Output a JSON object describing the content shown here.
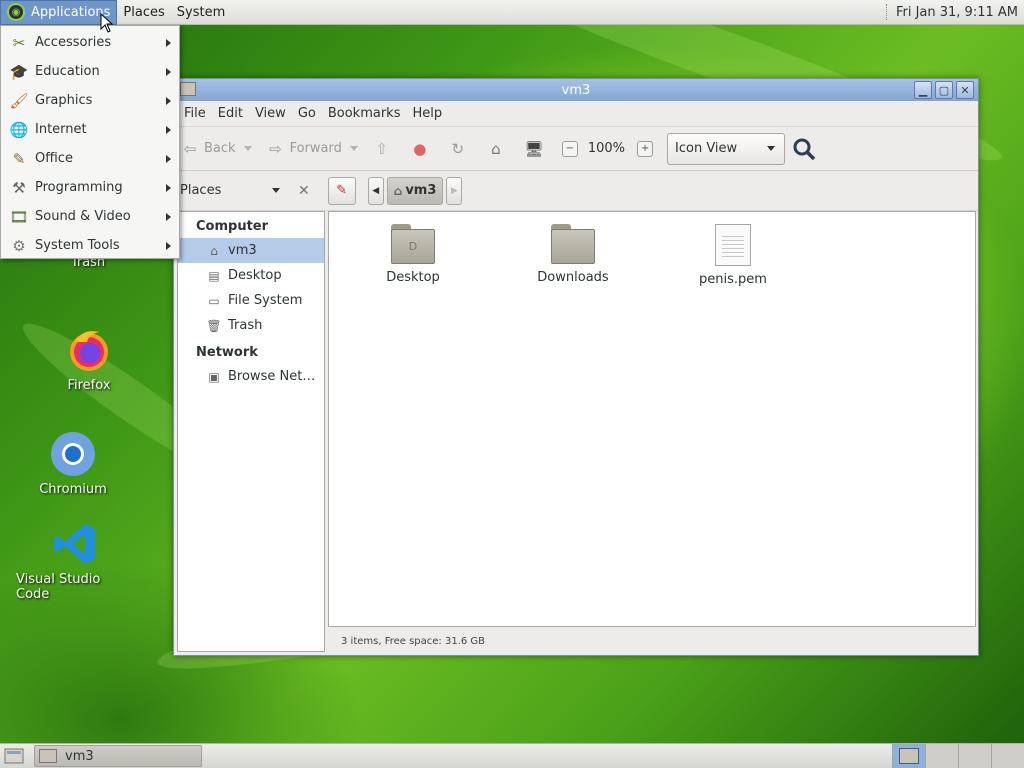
{
  "top_panel": {
    "menus": [
      "Applications",
      "Places",
      "System"
    ],
    "clock": "Fri Jan 31,  9:11 AM"
  },
  "apps_menu": {
    "items": [
      {
        "label": "Accessories",
        "icon": "accessories-icon"
      },
      {
        "label": "Education",
        "icon": "education-icon"
      },
      {
        "label": "Graphics",
        "icon": "graphics-icon"
      },
      {
        "label": "Internet",
        "icon": "internet-icon"
      },
      {
        "label": "Office",
        "icon": "office-icon"
      },
      {
        "label": "Programming",
        "icon": "programming-icon"
      },
      {
        "label": "Sound & Video",
        "icon": "sound-video-icon"
      },
      {
        "label": "System Tools",
        "icon": "system-tools-icon"
      }
    ]
  },
  "desktop": {
    "icons": [
      {
        "label": "Trash",
        "icon": "trash-icon"
      },
      {
        "label": "Firefox",
        "icon": "firefox-icon"
      },
      {
        "label": "Chromium",
        "icon": "chromium-icon"
      },
      {
        "label": "Visual Studio Code",
        "icon": "vscode-icon"
      }
    ]
  },
  "window": {
    "title": "vm3",
    "menubar": [
      "File",
      "Edit",
      "View",
      "Go",
      "Bookmarks",
      "Help"
    ],
    "toolbar": {
      "back": "Back",
      "forward": "Forward",
      "zoom": "100%",
      "view_mode": "Icon View"
    },
    "location": {
      "places_label": "Places",
      "crumb": "vm3"
    },
    "sidebar": {
      "sections": [
        {
          "title": "Computer",
          "items": [
            "vm3",
            "Desktop",
            "File System",
            "Trash"
          ]
        },
        {
          "title": "Network",
          "items": [
            "Browse Net…"
          ]
        }
      ],
      "selected": "vm3"
    },
    "files": [
      {
        "name": "Desktop",
        "type": "folder",
        "emblem": "D"
      },
      {
        "name": "Downloads",
        "type": "folder",
        "emblem": ""
      },
      {
        "name": "penis.pem",
        "type": "document",
        "emblem": ""
      }
    ],
    "status": "3 items, Free space: 31.6 GB"
  },
  "bottom_panel": {
    "task": "vm3",
    "workspaces": 4,
    "active_workspace": 1
  },
  "colors": {
    "selection": "#b4cbe9",
    "titlebar": "#84a5d3",
    "menu_highlight": "#6f96c9"
  }
}
